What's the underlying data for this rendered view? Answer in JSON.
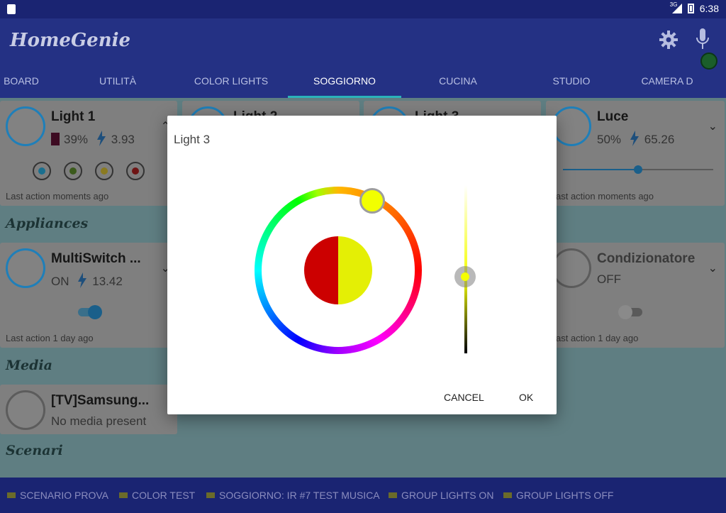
{
  "status": {
    "signal": "3G",
    "time": "6:38"
  },
  "app": {
    "title": "HomeGenie"
  },
  "tabs": [
    "BOARD",
    "UTILITÀ",
    "COLOR LIGHTS",
    "SOGGIORNO",
    "CUCINA",
    "STUDIO",
    "CAMERA D"
  ],
  "active_tab": "SOGGIORNO",
  "cards": {
    "light1": {
      "title": "Light 1",
      "level": "39%",
      "power": "3.93",
      "footer": "Last action moments ago"
    },
    "light2": {
      "title": "Light 2"
    },
    "light3": {
      "title": "Light 3"
    },
    "luce": {
      "title": "Luce",
      "level": "50%",
      "power": "65.26",
      "footer": "ast action moments ago"
    },
    "multiswitch": {
      "title": "MultiSwitch ...",
      "state": "ON",
      "power": "13.42",
      "footer": "Last action 1 day ago"
    },
    "condizionatore": {
      "title": "Condizionatore",
      "state": "OFF",
      "footer": "ast action 1 day ago"
    },
    "tv": {
      "title": "[TV]Samsung...",
      "subtitle": "No media present"
    }
  },
  "sections": {
    "appliances": "Appliances",
    "media": "Media",
    "scenari": "Scenari"
  },
  "scenarios": [
    "SCENARIO PROVA",
    "COLOR TEST",
    "SOGGIORNO: IR #7 TEST MUSICA",
    "GROUP LIGHTS ON",
    "GROUP LIGHTS OFF"
  ],
  "dialog": {
    "title": "Light 3",
    "cancel": "CANCEL",
    "ok": "OK",
    "brightness": 0.5
  },
  "colors": {
    "primary": "#243184",
    "accent": "#2bb3b9",
    "selected_color": "#e4ef05",
    "previous_color": "#cc0000"
  }
}
